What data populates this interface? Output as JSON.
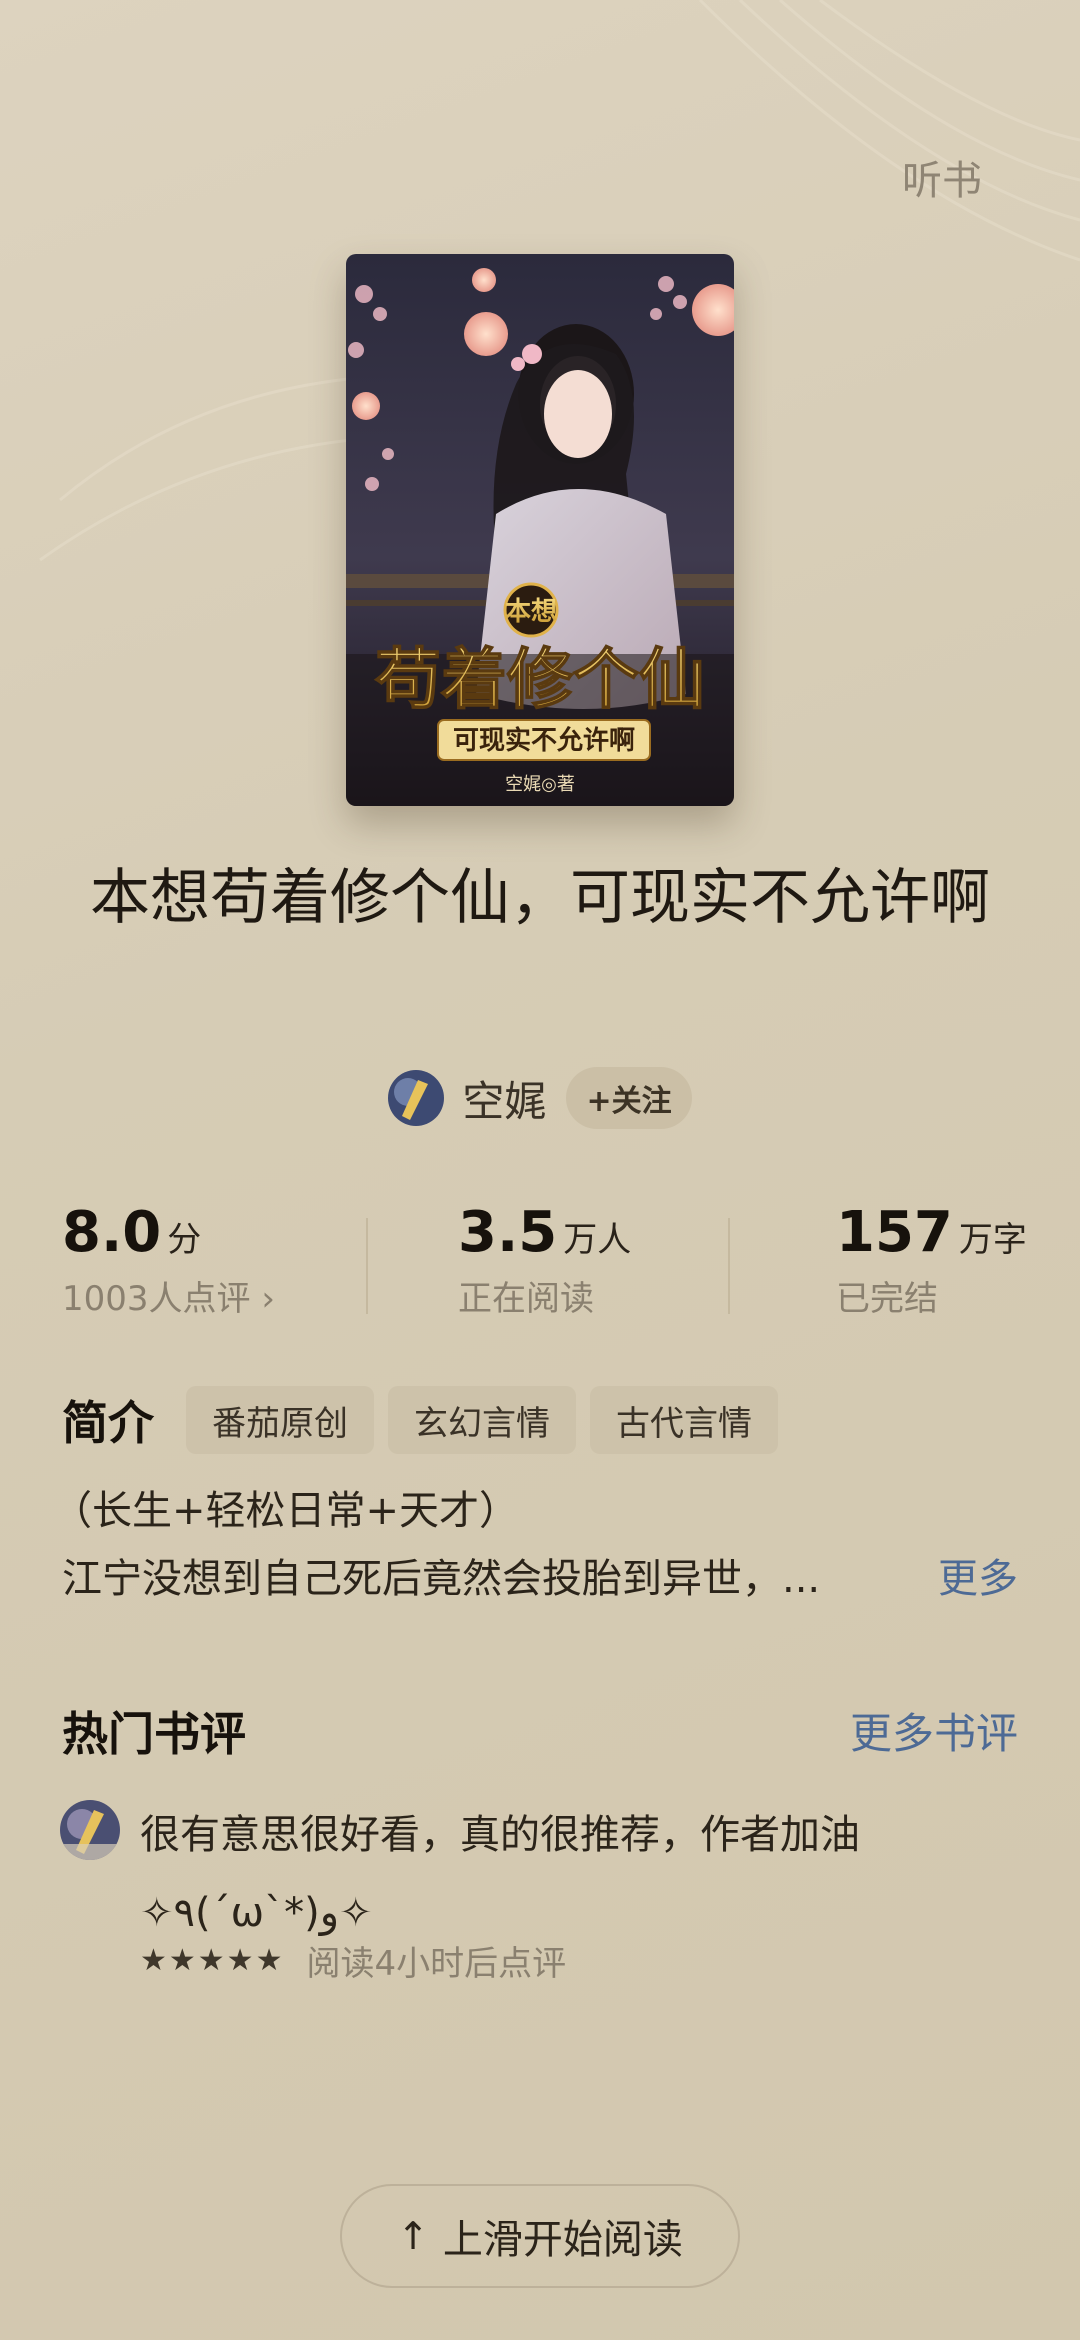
{
  "header": {
    "listen_label": "听书"
  },
  "book": {
    "title": "本想苟着修个仙，可现实不允许啊",
    "cover_icon": "book-cover-image",
    "cover_title_top": "本想",
    "cover_title_main": "苟着修个仙",
    "cover_title_sub": "可现实不允许啊",
    "cover_author": "空娓◎著"
  },
  "author": {
    "name": "空娓",
    "follow_label": "+关注"
  },
  "stats": {
    "rating": {
      "value": "8.0",
      "unit": "分",
      "sub": "1003人点评 ›"
    },
    "readers": {
      "value": "3.5",
      "unit": "万人",
      "sub": "正在阅读"
    },
    "words": {
      "value": "157",
      "unit": "万字",
      "sub": "已完结"
    }
  },
  "intro": {
    "label": "简介",
    "tags": [
      "番茄原创",
      "玄幻言情",
      "古代言情"
    ],
    "line1": "（长生+轻松日常+天才）",
    "line2": "江宁没想到自己死后竟然会投胎到异世，...",
    "more_label": "更多"
  },
  "reviews": {
    "title": "热门书评",
    "more_label": "更多书评",
    "items": [
      {
        "text": "很有意思很好看，真的很推荐，作者加油✧٩(ˊωˋ*)و✧",
        "stars": "★★★★★",
        "rating": 5,
        "time": "阅读4小时后点评"
      }
    ]
  },
  "bottom": {
    "read_label": "上滑开始阅读",
    "arrow": "↑"
  },
  "colors": {
    "accent_link": "#4d6a95",
    "background": "#d6ccb5"
  }
}
